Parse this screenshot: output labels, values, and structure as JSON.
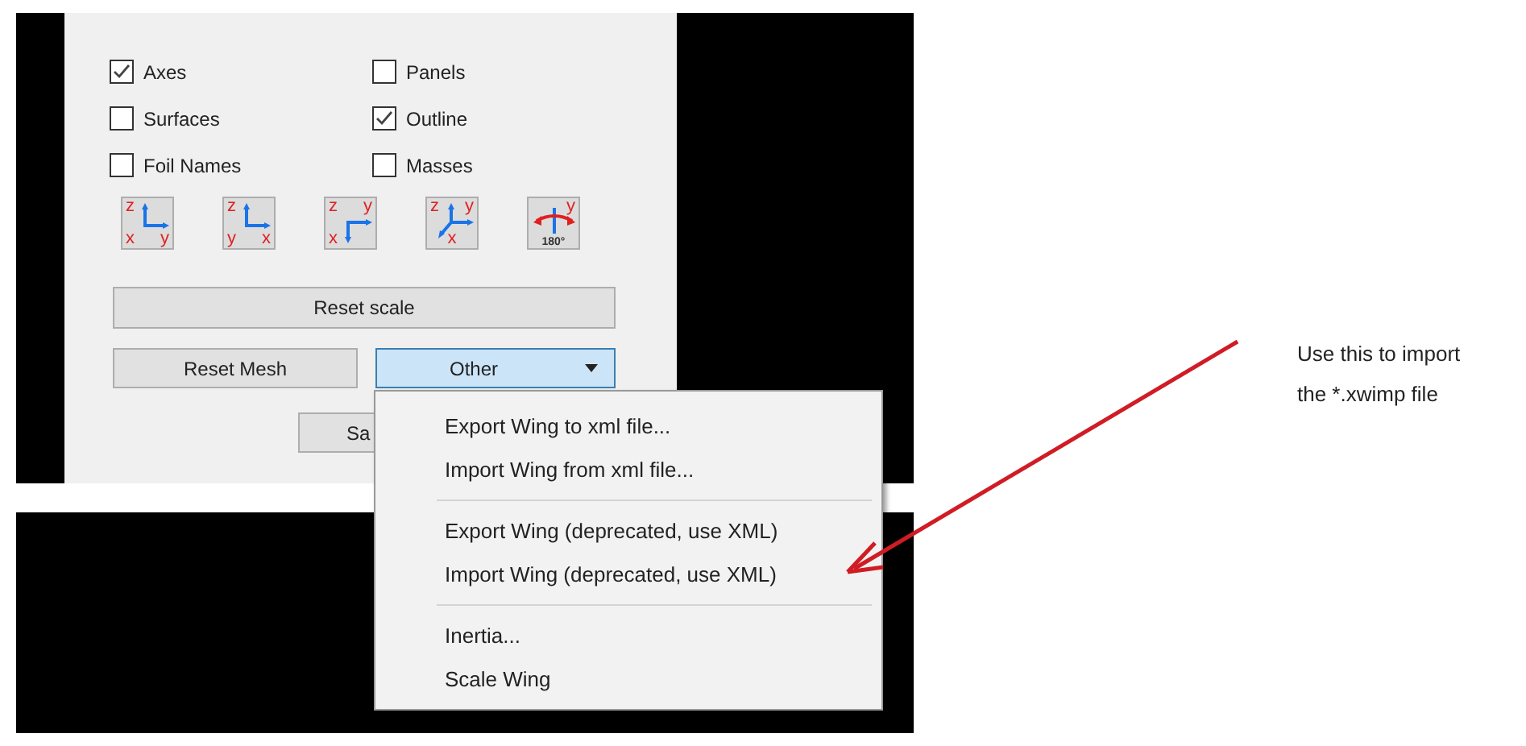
{
  "display_options": [
    {
      "label": "Axes",
      "checked": true
    },
    {
      "label": "Panels",
      "checked": false
    },
    {
      "label": "Surfaces",
      "checked": false
    },
    {
      "label": "Outline",
      "checked": true
    },
    {
      "label": "Foil Names",
      "checked": false
    },
    {
      "label": "Masses",
      "checked": false
    }
  ],
  "view_buttons": [
    {
      "kind": "front",
      "labels": [
        "z",
        "x",
        "y"
      ]
    },
    {
      "kind": "side",
      "labels": [
        "z",
        "y",
        "x"
      ]
    },
    {
      "kind": "top",
      "labels": [
        "z",
        "y",
        "x"
      ]
    },
    {
      "kind": "iso",
      "labels": [
        "z",
        "y",
        "x"
      ]
    },
    {
      "kind": "flip",
      "labels": [
        "y",
        "180°"
      ]
    }
  ],
  "reset_scale": "Reset scale",
  "reset_mesh": "Reset Mesh",
  "other_dropdown": {
    "label": "Other",
    "expanded": true
  },
  "hidden_button": "Sa",
  "other_menu": [
    [
      {
        "label": "Export Wing to xml file..."
      },
      {
        "label": "Import Wing from xml file..."
      }
    ],
    [
      {
        "label": "Export Wing (deprecated, use XML)"
      },
      {
        "label": "Import Wing (deprecated, use XML)"
      }
    ],
    [
      {
        "label": "Inertia..."
      },
      {
        "label": "Scale Wing"
      }
    ]
  ],
  "annotation": {
    "lines": [
      "Use this to import",
      "the *.xwimp file"
    ]
  }
}
